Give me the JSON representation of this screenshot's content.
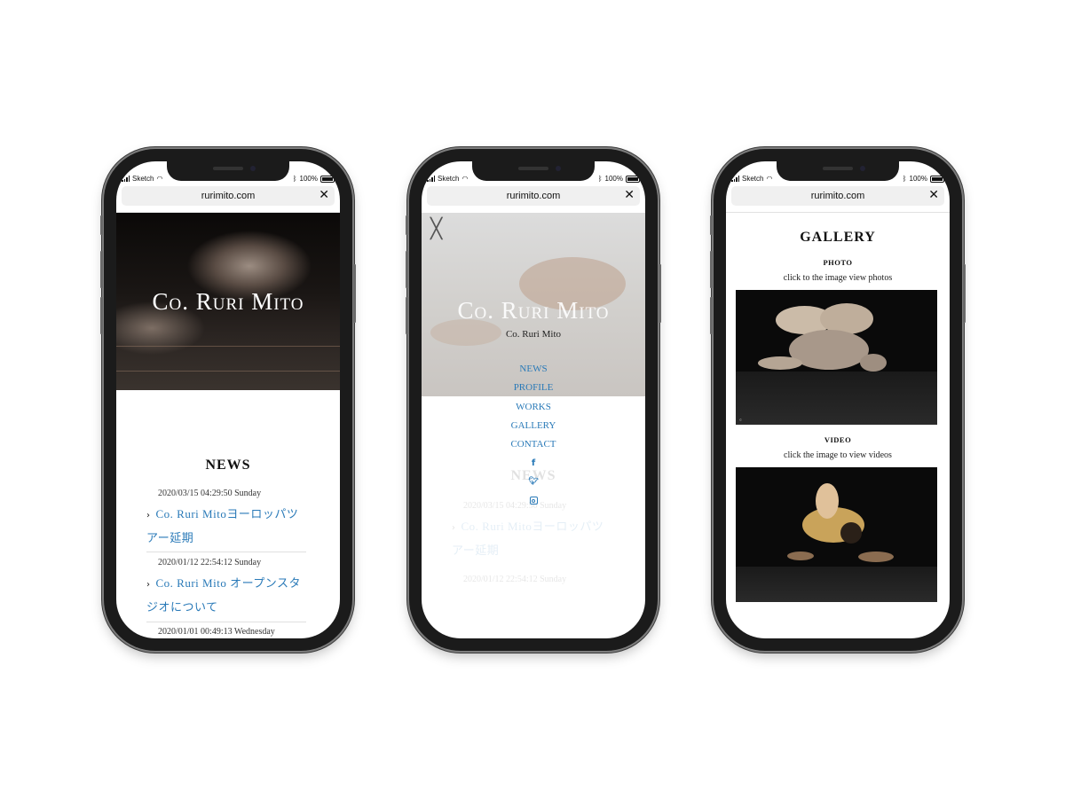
{
  "status_bar": {
    "carrier": "Sketch",
    "battery": "100%"
  },
  "browser": {
    "url": "rurimito.com",
    "close_icon": "close-icon"
  },
  "home": {
    "hero_title": "Co. Ruri Mito",
    "news_heading": "NEWS",
    "news": [
      {
        "date": "2020/03/15 04:29:50 Sunday",
        "title": "Co. Ruri Mitoヨーロッパツアー延期"
      },
      {
        "date": "2020/01/12 22:54:12 Sunday",
        "title": "Co. Ruri Mito オープンスタジオについて"
      },
      {
        "date": "2020/01/01 00:49:13 Wednesday"
      }
    ]
  },
  "menu": {
    "hero_title": "Co. Ruri Mito",
    "subtitle": "Co. Ruri Mito",
    "items": [
      "NEWS",
      "PROFILE",
      "WORKS",
      "GALLERY",
      "CONTACT"
    ],
    "social": [
      "facebook-icon",
      "twitter-icon",
      "instagram-icon"
    ],
    "ghost_news_heading": "NEWS",
    "ghost_news": [
      {
        "date": "2020/03/15 04:29:50 Sunday",
        "title": "Co. Ruri Mitoヨーロッパツアー延期"
      },
      {
        "date": "2020/01/12 22:54:12 Sunday"
      }
    ]
  },
  "gallery": {
    "heading": "GALLERY",
    "photo_label": "PHOTO",
    "photo_caption": "click to the image view photos",
    "video_label": "VIDEO",
    "video_caption": "click the image to view videos"
  },
  "colors": {
    "link": "#2a7ab8",
    "frame": "#1b1b1b"
  }
}
